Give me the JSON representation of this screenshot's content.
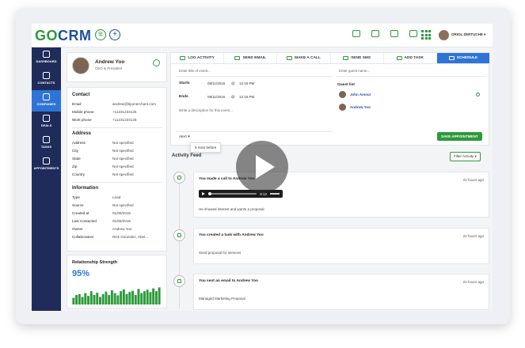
{
  "app": {
    "logo_go": "G",
    "logo_o": "O",
    "logo_crm": "CRM"
  },
  "topbar": {
    "user_name": "ORIOL ZERTUCHE ▾"
  },
  "sidebar": {
    "items": [
      {
        "label": "DASHBOARD"
      },
      {
        "label": "CONTACTS"
      },
      {
        "label": "COMPANIES"
      },
      {
        "label": "DEALS"
      },
      {
        "label": "TASKS"
      },
      {
        "label": "APPOINTMENTS"
      }
    ]
  },
  "profile": {
    "name": "Andrew Yoo",
    "title": "CEO & President"
  },
  "contact": {
    "title": "Contact",
    "rows": [
      {
        "k": "Email",
        "v": "andrew@tiponerchant.com"
      },
      {
        "k": "Mobile phone",
        "v": "+11231234125"
      },
      {
        "k": "Work phone",
        "v": "+11231234125"
      }
    ]
  },
  "address": {
    "title": "Address",
    "rows": [
      {
        "k": "Address",
        "v": "Not specified"
      },
      {
        "k": "City",
        "v": "Not specified"
      },
      {
        "k": "State",
        "v": "Not specified"
      },
      {
        "k": "Zip",
        "v": "Not specified"
      },
      {
        "k": "Country",
        "v": "Not specified"
      }
    ]
  },
  "information": {
    "title": "Information",
    "rows": [
      {
        "k": "Type",
        "v": "Lead"
      },
      {
        "k": "Source",
        "v": "Not specified"
      },
      {
        "k": "Created at",
        "v": "01/05/2015"
      },
      {
        "k": "Last Contacted",
        "v": "01/06/2015"
      },
      {
        "k": "Owner",
        "v": "Andrew Yoo"
      },
      {
        "k": "Collaborators",
        "v": "Rick Gonzalez, Abel..."
      }
    ]
  },
  "relationship": {
    "title": "Relationship Strength",
    "value": "95%",
    "bars": [
      0.35,
      0.5,
      0.55,
      0.4,
      0.6,
      0.45,
      0.7,
      0.5,
      0.62,
      0.4,
      0.55,
      0.68,
      0.5,
      0.75,
      0.6,
      0.48,
      0.7,
      0.8,
      0.55,
      0.66,
      0.72,
      0.5,
      0.82,
      0.6,
      0.7,
      0.78,
      0.65,
      0.85,
      0.7,
      0.9
    ]
  },
  "tabs": [
    {
      "label": "LOG ACTIVITY"
    },
    {
      "label": "SEND EMAIL"
    },
    {
      "label": "MAKE A CALL"
    },
    {
      "label": "SEND SMS"
    },
    {
      "label": "ADD TASK"
    },
    {
      "label": "SCHEDULE"
    }
  ],
  "schedule": {
    "title_placeholder": "Enter title of event...",
    "guest_placeholder": "Enter guest name...",
    "starts_label": "Starts",
    "starts_date": "08/11/2015",
    "starts_at": "@",
    "starts_time": "12:15 PM",
    "ends_label": "Ends",
    "ends_date": "08/11/2015",
    "ends_at": "@",
    "ends_time": "12:15 PM",
    "desc_placeholder": "Write a description for this event...",
    "alert_label": "Alert ▾",
    "alert_option": "5 mins before",
    "guest_list_label": "Guest list",
    "guests": [
      "John Amour",
      "Andrew Yoo"
    ],
    "save_label": "SAVE APPOINTMENT"
  },
  "feed": {
    "title": "Activity Feed",
    "filter": "Filter Activity ▾",
    "items": [
      {
        "head": "You made a call to Andrew Yoo",
        "time": "22 hours ago",
        "detail": "He showed interest and wants a proposal",
        "audio_time": "8:12"
      },
      {
        "head": "You created a task with Andrew Yoo",
        "time": "22 hours ago",
        "detail": "Send proposal for services"
      },
      {
        "head": "You sent an email to Andrew Yoo",
        "time": "22 hours ago",
        "detail": "Managed Marketing Proposal"
      }
    ]
  },
  "colors": {
    "accent": "#2d9a3a",
    "primary": "#2e74d6",
    "sidebar": "#1f2b5a"
  }
}
